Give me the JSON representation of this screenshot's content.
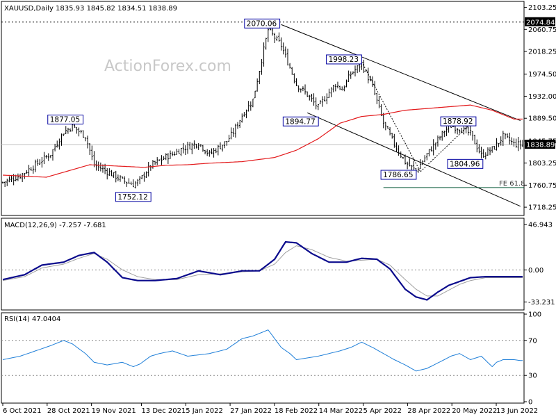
{
  "watermark": "ActionForex.com",
  "colors": {
    "candle": "#000000",
    "ma": "#e31a1c",
    "macd": "#0a0a8c",
    "signal": "#a0a0a0",
    "rsi": "#1f7fd8",
    "annotation_border": "#0000a0",
    "grid": "#888888"
  },
  "chart_data": [
    {
      "type": "candlestick",
      "title": "XAUUSD,Daily  1835.93 1845.82 1834.51 1838.89",
      "ylim": [
        1705,
        2112
      ],
      "yticks": [
        "2103.25",
        "2060.75",
        "2018.25",
        "1974.50",
        "1932.00",
        "1889.50",
        "1845.75",
        "1803.25",
        "1760.75",
        "1718.25"
      ],
      "last_price": "1838.89",
      "ref_level": "2074.84",
      "ma_series": {
        "x": [
          0,
          20,
          40,
          55,
          65,
          75,
          85,
          95,
          110,
          125,
          135,
          145,
          155,
          165,
          175,
          185,
          200,
          215,
          225,
          235
        ],
        "y": [
          1780,
          1776,
          1800,
          1797,
          1795,
          1799,
          1800,
          1803,
          1806,
          1814,
          1828,
          1850,
          1880,
          1893,
          1897,
          1905,
          1910,
          1915,
          1905,
          1888
        ]
      },
      "price_path": {
        "x": [
          0,
          8,
          15,
          22,
          28,
          32,
          38,
          42,
          48,
          55,
          60,
          63,
          68,
          72,
          75,
          78,
          82,
          90,
          95,
          103,
          106,
          110,
          115,
          122,
          128,
          135,
          140,
          145,
          150,
          153,
          156,
          160,
          165,
          170,
          175,
          180,
          185,
          190,
          195,
          203,
          206,
          210,
          215,
          220,
          225,
          227,
          230,
          235,
          238
        ],
        "y": [
          1766,
          1779,
          1800,
          1821,
          1863,
          1874,
          1855,
          1800,
          1787,
          1770,
          1762,
          1770,
          1798,
          1808,
          1815,
          1820,
          1830,
          1842,
          1820,
          1845,
          1863,
          1895,
          1925,
          2060,
          2030,
          1955,
          1935,
          1910,
          1940,
          1955,
          1945,
          1975,
          1995,
          1950,
          1880,
          1840,
          1805,
          1788,
          1820,
          1865,
          1875,
          1870,
          1860,
          1818,
          1830,
          1838,
          1855,
          1840,
          1839
        ]
      },
      "annotations": [
        {
          "label": "2070.06",
          "x": 128,
          "y": 2070.06
        },
        {
          "label": "1998.23",
          "x": 165,
          "y": 1998.23
        },
        {
          "label": "1877.05",
          "x": 32,
          "y": 1877.05
        },
        {
          "label": "1894.77",
          "x": 140,
          "y": 1894.77
        },
        {
          "label": "1878.92",
          "x": 215,
          "y": 1878.92
        },
        {
          "label": "1752.12",
          "x": 60,
          "y": 1752.12
        },
        {
          "label": "1786.65",
          "x": 192,
          "y": 1786.65
        },
        {
          "label": "1804.96",
          "x": 222,
          "y": 1804.96
        }
      ],
      "fe_label": "FE 61.8",
      "fe_level": 1756,
      "channel_upper": {
        "x": [
          128,
          238
        ],
        "y": [
          2070,
          1885
        ]
      },
      "channel_lower": {
        "x": [
          140,
          238
        ],
        "y": [
          1900,
          1720
        ]
      }
    },
    {
      "type": "line",
      "title": "MACD(12,26,9) -7.257 -7.681",
      "ylim": [
        -40,
        52
      ],
      "yticks": [
        "46.943",
        "0.00",
        "-33.231"
      ],
      "series": [
        {
          "name": "MACD",
          "x": [
            0,
            10,
            18,
            28,
            35,
            42,
            48,
            55,
            62,
            70,
            80,
            90,
            100,
            110,
            118,
            125,
            130,
            135,
            142,
            150,
            158,
            165,
            172,
            178,
            185,
            190,
            195,
            200,
            205,
            210,
            215,
            222,
            225
          ],
          "y": [
            -10,
            -5,
            5,
            8,
            15,
            18,
            8,
            -8,
            -11,
            -11,
            -9,
            -1,
            -5,
            -1,
            -1,
            11,
            29,
            28,
            17,
            8,
            8,
            12,
            11,
            1,
            -20,
            -28,
            -31,
            -23,
            -16,
            -12,
            -8,
            -7,
            -7
          ]
        },
        {
          "name": "Signal",
          "x": [
            0,
            10,
            18,
            28,
            35,
            42,
            48,
            55,
            62,
            70,
            80,
            90,
            100,
            110,
            118,
            125,
            130,
            135,
            142,
            150,
            158,
            165,
            172,
            178,
            185,
            190,
            195,
            200,
            205,
            210,
            215,
            222,
            225
          ],
          "y": [
            -11,
            -7,
            2,
            6,
            12,
            17,
            11,
            0,
            -7,
            -10,
            -10,
            -5,
            -4,
            -2,
            -1,
            6,
            18,
            25,
            21,
            13,
            9,
            10,
            11,
            5,
            -10,
            -20,
            -27,
            -27,
            -21,
            -15,
            -11,
            -8,
            -8
          ]
        }
      ]
    },
    {
      "type": "line",
      "title": "RSI(14) 47.0404",
      "ylim": [
        0,
        100
      ],
      "yticks": [
        "100",
        "70",
        "30",
        "0"
      ],
      "series": [
        {
          "name": "RSI",
          "x": [
            0,
            8,
            15,
            22,
            28,
            32,
            38,
            42,
            48,
            55,
            60,
            63,
            68,
            72,
            78,
            85,
            95,
            103,
            110,
            115,
            122,
            128,
            132,
            135,
            140,
            145,
            150,
            155,
            160,
            165,
            170,
            175,
            180,
            185,
            190,
            195,
            203,
            206,
            210,
            215,
            220,
            225,
            227,
            230,
            235,
            238
          ],
          "y": [
            48,
            52,
            58,
            64,
            70,
            66,
            55,
            45,
            42,
            45,
            40,
            43,
            52,
            55,
            58,
            52,
            55,
            60,
            72,
            75,
            82,
            62,
            55,
            48,
            50,
            52,
            55,
            58,
            62,
            68,
            62,
            55,
            48,
            42,
            35,
            38,
            48,
            52,
            55,
            48,
            52,
            40,
            45,
            48,
            48,
            47
          ]
        }
      ],
      "levels": [
        70,
        30
      ]
    }
  ],
  "x_axis": {
    "count": 240,
    "labels": [
      {
        "text": "6 Oct 2021",
        "x": 0
      },
      {
        "text": "28 Oct 2021",
        "x": 16
      },
      {
        "text": "19 Nov 2021",
        "x": 32
      },
      {
        "text": "13 Dec 2021",
        "x": 50
      },
      {
        "text": "5 Jan 2022",
        "x": 66
      },
      {
        "text": "27 Jan 2022",
        "x": 82
      },
      {
        "text": "18 Feb 2022",
        "x": 98
      },
      {
        "text": "14 Mar 2022",
        "x": 114
      },
      {
        "text": "5 Apr 2022",
        "x": 130
      },
      {
        "text": "28 Apr 2022",
        "x": 146
      },
      {
        "text": "20 May 2022",
        "x": 162
      },
      {
        "text": "13 Jun 2022",
        "x": 178
      }
    ]
  }
}
